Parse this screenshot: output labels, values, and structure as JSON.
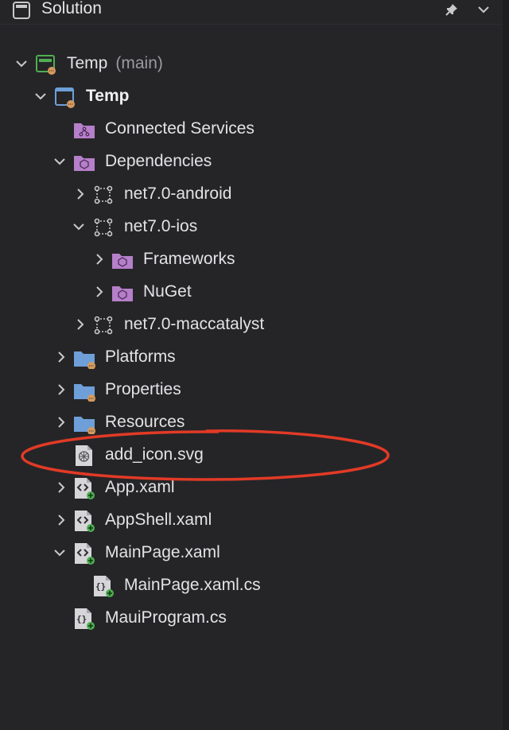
{
  "header": {
    "title": "Solution",
    "pin_icon": "pin-icon",
    "menu_icon": "chevron-down-icon"
  },
  "tree": {
    "solution": {
      "label": "Temp",
      "branch": "(main)"
    },
    "project": {
      "label": "Temp"
    },
    "connected_services": {
      "label": "Connected Services"
    },
    "dependencies": {
      "label": "Dependencies"
    },
    "net_android": {
      "label": "net7.0-android"
    },
    "net_ios": {
      "label": "net7.0-ios"
    },
    "frameworks": {
      "label": "Frameworks"
    },
    "nuget": {
      "label": "NuGet"
    },
    "net_maccatalyst": {
      "label": "net7.0-maccatalyst"
    },
    "platforms": {
      "label": "Platforms"
    },
    "properties": {
      "label": "Properties"
    },
    "resources": {
      "label": "Resources"
    },
    "add_icon": {
      "label": "add_icon.svg"
    },
    "app_xaml": {
      "label": "App.xaml"
    },
    "appshell_xaml": {
      "label": "AppShell.xaml"
    },
    "mainpage_xaml": {
      "label": "MainPage.xaml"
    },
    "mainpage_cs": {
      "label": "MainPage.xaml.cs"
    },
    "mauiprogram_cs": {
      "label": "MauiProgram.cs"
    }
  },
  "colors": {
    "background": "#252528",
    "text": "#e3e3e6",
    "folder_blue": "#6e9fd8",
    "folder_purple": "#b67fc9",
    "badge_orange": "#d49a5e",
    "badge_green": "#4fae52",
    "annotation_red": "#e23a26"
  }
}
